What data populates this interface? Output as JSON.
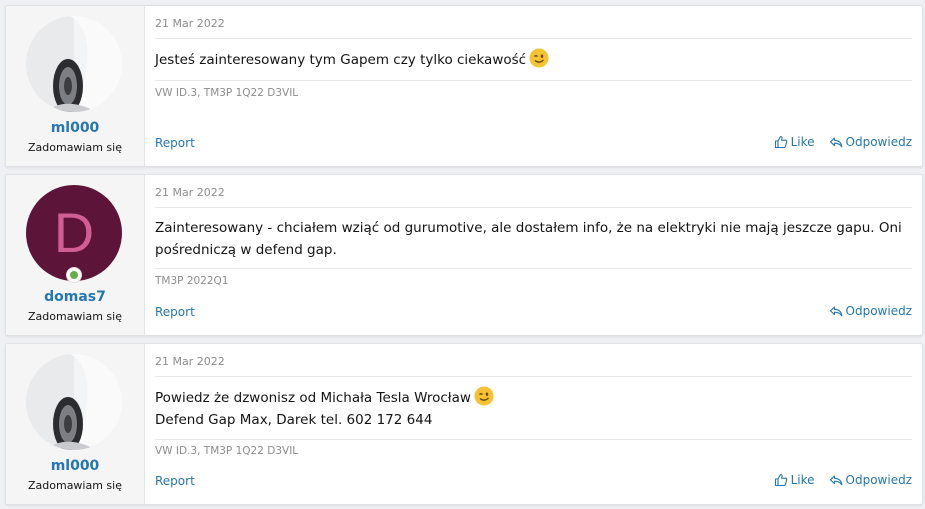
{
  "posts": [
    {
      "date": "21 Mar 2022",
      "username": "ml000",
      "user_title": "Zadomawiam się",
      "avatar": "car-photo",
      "lines": [
        "Jesteś zainteresowany tym Gapem czy tylko ciekawość"
      ],
      "emoji": "winking-face",
      "signature": "VW ID.3, TM3P 1Q22 D3VIL",
      "report": "Report",
      "like": "Like",
      "reply": "Odpowiedz"
    },
    {
      "date": "21 Mar 2022",
      "username": "domas7",
      "user_title": "Zadomawiam się",
      "avatar_letter": "D",
      "avatar_bg": "#5c1538",
      "online": true,
      "lines": [
        "Zainteresowany - chciałem wziąć od gurumotive, ale dostałem info, że na elektryki nie mają jeszcze gapu. Oni pośredniczą w defend gap."
      ],
      "signature": "TM3P 2022Q1",
      "report": "Report",
      "reply": "Odpowiedz"
    },
    {
      "date": "21 Mar 2022",
      "username": "ml000",
      "user_title": "Zadomawiam się",
      "avatar": "car-photo",
      "lines": [
        "Powiedz że dzwonisz od Michała Tesla Wrocław",
        "Defend Gap Max, Darek tel. 602 172 644"
      ],
      "emoji": "winking-face",
      "signature": "VW ID.3, TM3P 1Q22 D3VIL",
      "report": "Report",
      "like": "Like",
      "reply": "Odpowiedz"
    }
  ],
  "colors": {
    "link": "#2577b1",
    "muted": "#8c8c8c",
    "online": "#63b047"
  }
}
